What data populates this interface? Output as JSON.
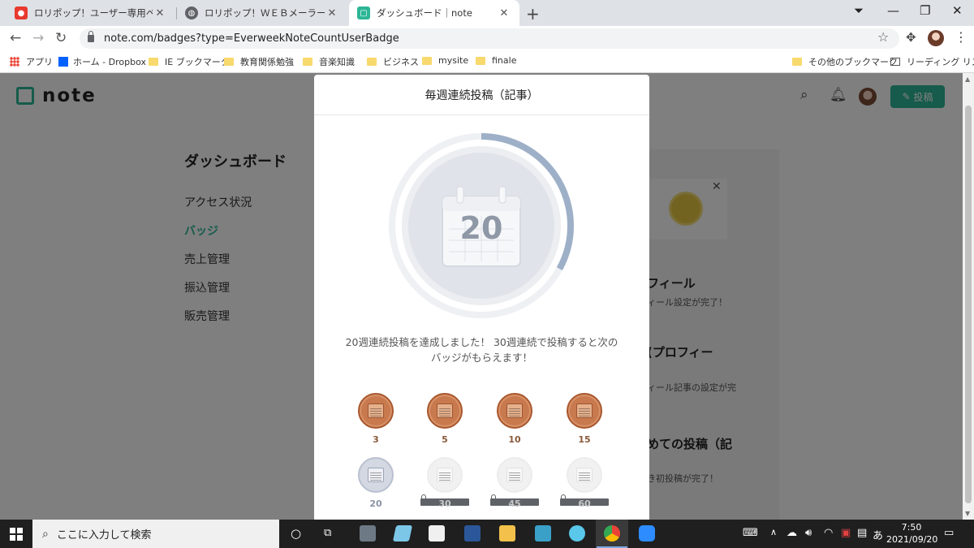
{
  "browser": {
    "tabs": [
      {
        "title": "ロリポップ！ユーザー専用ページ - メー",
        "close": "✕"
      },
      {
        "title": "ロリポップ！ＷＥＢメーラー",
        "close": "✕"
      },
      {
        "title": "ダッシュボード｜note",
        "close": "✕"
      }
    ],
    "new_tab": "+",
    "url": "note.com/badges?type=EverweekNoteCountUserBadge",
    "bookmarks": [
      "アプリ",
      "ホーム - Dropbox",
      "IE ブックマーク",
      "教育関係勉強",
      "音楽知識",
      "ビジネス",
      "mysite",
      "finale"
    ],
    "bookmarks_right": [
      "その他のブックマーク",
      "リーディング リスト"
    ]
  },
  "note": {
    "logo_text": "note",
    "post_button": "投稿",
    "sidebar_title": "ダッシュボード",
    "sidebar_items": [
      "アクセス状況",
      "バッジ",
      "売上管理",
      "振込管理",
      "販売管理"
    ],
    "achievements": [
      {
        "title": "フィール",
        "sub": "ィール設定が完了！"
      },
      {
        "title": "(プロフィー",
        "sub": "ィール記事の設定が完"
      },
      {
        "title": "めての投稿（記",
        "sub": "き初投稿が完了！"
      }
    ]
  },
  "modal": {
    "title": "毎週連続投稿（記事）",
    "current_badge": "20",
    "progress": 0.33,
    "message_line1": "20週連続投稿を達成しました！ 30週連続で投稿すると次の",
    "message_line2": "バッジがもらえます！",
    "badges": [
      {
        "label": "3",
        "tier": "bronze"
      },
      {
        "label": "5",
        "tier": "bronze"
      },
      {
        "label": "10",
        "tier": "bronze"
      },
      {
        "label": "15",
        "tier": "bronze"
      },
      {
        "label": "20",
        "tier": "silver"
      },
      {
        "label": "30",
        "tier": "locked"
      },
      {
        "label": "45",
        "tier": "locked"
      },
      {
        "label": "60",
        "tier": "locked"
      }
    ]
  },
  "taskbar": {
    "search_placeholder": "ここに入力して検索",
    "ime": "あ",
    "time": "7:50",
    "date": "2021/09/20"
  },
  "colors": {
    "note_green": "#2cb696",
    "bronze": "#c8794e",
    "progress_ring": "#9eb0c8"
  }
}
